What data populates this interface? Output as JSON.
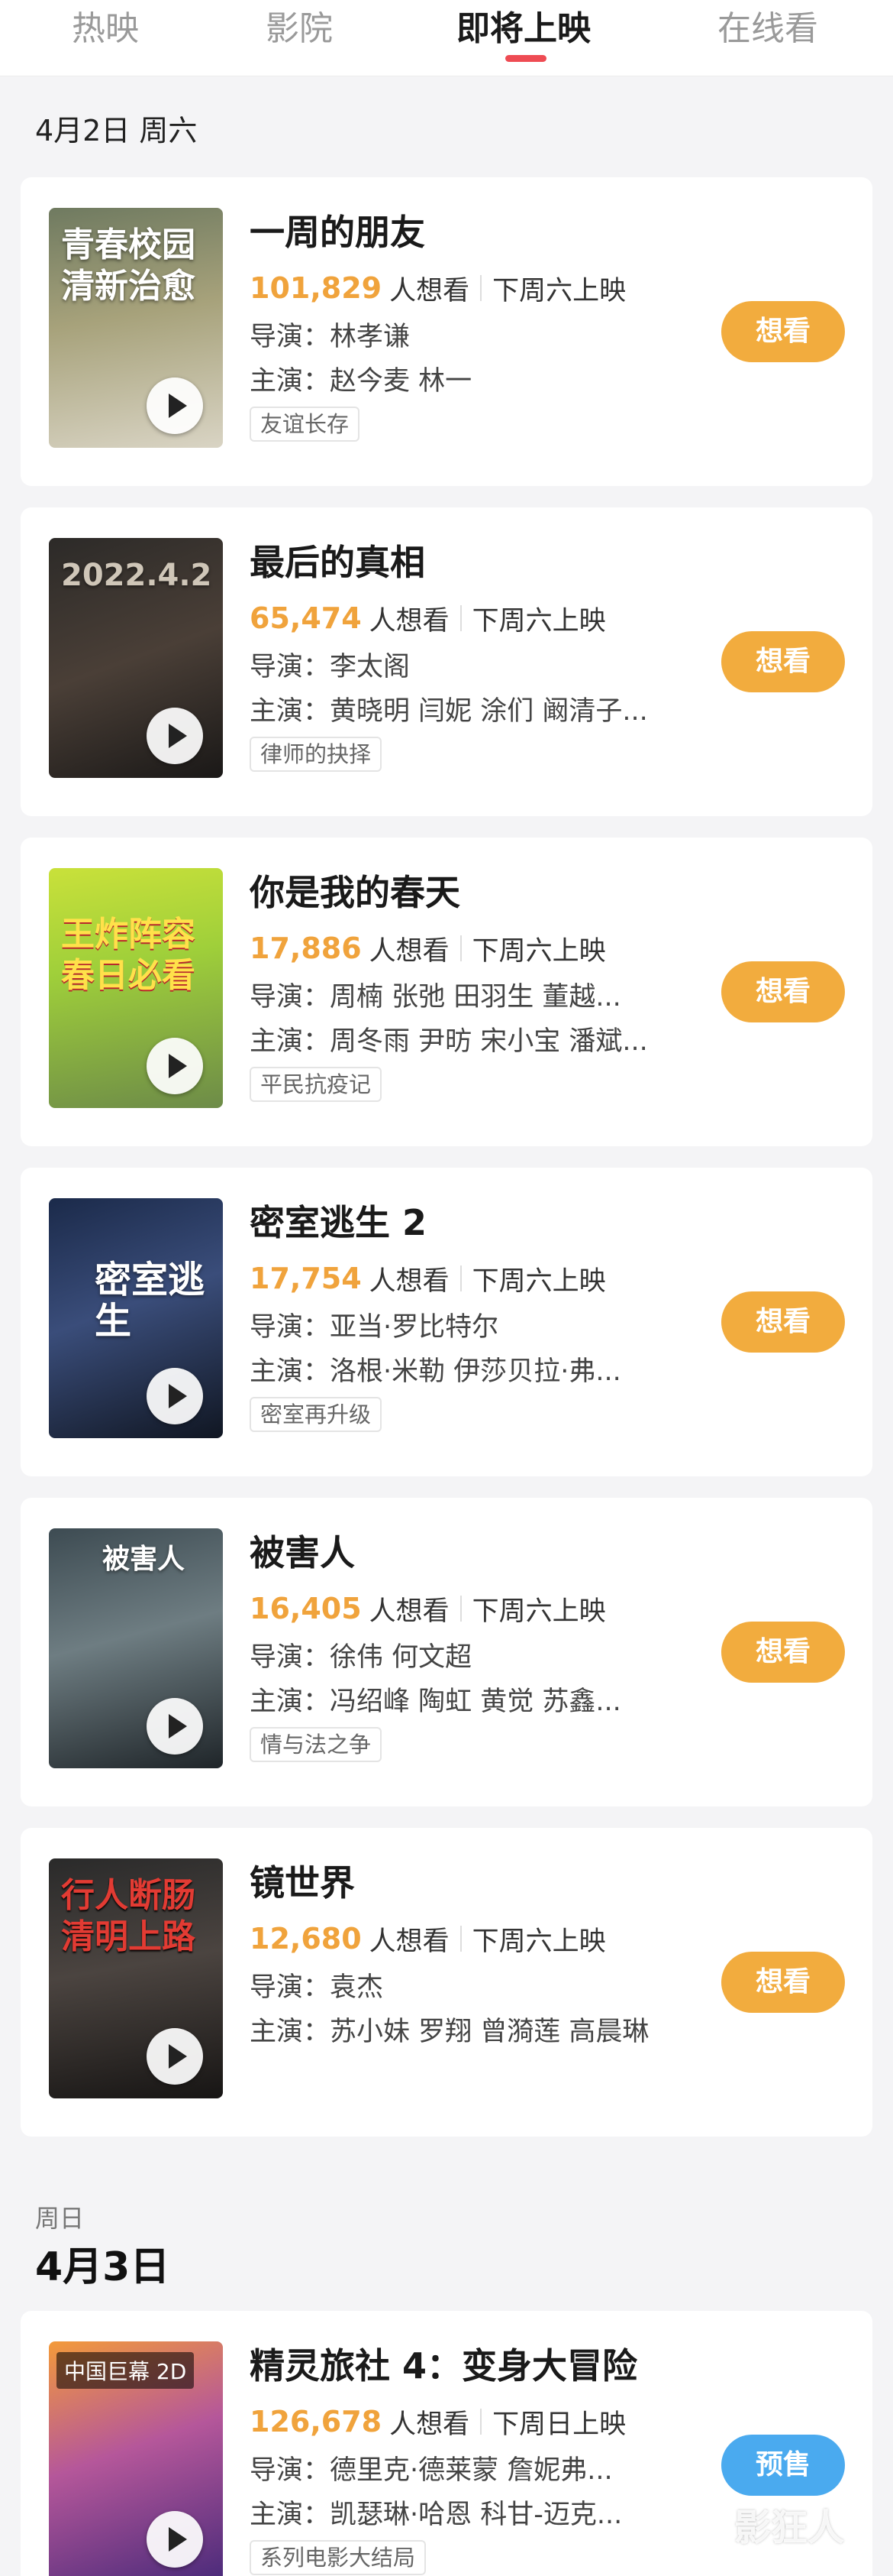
{
  "tabs": [
    {
      "label": "热映"
    },
    {
      "label": "影院"
    },
    {
      "label": "即将上映"
    },
    {
      "label": "在线看"
    }
  ],
  "accent_color": "#ee4b53",
  "count_color": "#f0a33c",
  "days": [
    {
      "date_line": "4月2日 周六"
    },
    {
      "weekday": "周日",
      "date": "4月3日"
    }
  ],
  "movies": [
    {
      "title": "一周的朋友",
      "count": "101,829",
      "count_suffix": "人想看",
      "release": "下周六上映",
      "director": "导演：林孝谦",
      "cast": "主演：赵今麦 林一",
      "tag": "友谊长存",
      "button": "想看",
      "poster_text": "青春校园 清新治愈",
      "poster_badge": ""
    },
    {
      "title": "最后的真相",
      "count": "65,474",
      "count_suffix": "人想看",
      "release": "下周六上映",
      "director": "导演：李太阁",
      "cast": "主演：黄晓明 闫妮 涂们 阚清子...",
      "tag": "律师的抉择",
      "button": "想看",
      "poster_text": "2022.4.2",
      "poster_badge": ""
    },
    {
      "title": "你是我的春天",
      "count": "17,886",
      "count_suffix": "人想看",
      "release": "下周六上映",
      "director": "导演：周楠 张弛 田羽生 董越...",
      "cast": "主演：周冬雨 尹昉 宋小宝 潘斌...",
      "tag": "平民抗疫记",
      "button": "想看",
      "poster_text": "王炸阵容 春日必看",
      "poster_badge": ""
    },
    {
      "title": "密室逃生 2",
      "count": "17,754",
      "count_suffix": "人想看",
      "release": "下周六上映",
      "director": "导演：亚当·罗比特尔",
      "cast": "主演：洛根·米勒 伊莎贝拉·弗...",
      "tag": "密室再升级",
      "button": "想看",
      "poster_text": "密室逃生",
      "poster_badge": ""
    },
    {
      "title": "被害人",
      "count": "16,405",
      "count_suffix": "人想看",
      "release": "下周六上映",
      "director": "导演：徐伟 何文超",
      "cast": "主演：冯绍峰 陶虹 黄觉 苏鑫...",
      "tag": "情与法之争",
      "button": "想看",
      "poster_text": "被害人",
      "poster_badge": ""
    },
    {
      "title": "镜世界",
      "count": "12,680",
      "count_suffix": "人想看",
      "release": "下周六上映",
      "director": "导演：袁杰",
      "cast": "主演：苏小妹 罗翔 曾漪莲 高晨琳",
      "tag": "",
      "button": "想看",
      "poster_text": "行人断肠 清明上路",
      "poster_badge": ""
    },
    {
      "title": "精灵旅社 4：变身大冒险",
      "count": "126,678",
      "count_suffix": "人想看",
      "release": "下周日上映",
      "director": "导演：德里克·德莱蒙 詹妮弗...",
      "cast": "主演：凯瑟琳·哈恩 科甘-迈克...",
      "tag": "系列电影大结局",
      "button": "预售",
      "poster_text": "",
      "poster_badge": "中国巨幕 2D"
    }
  ],
  "watermark": "影狂人"
}
